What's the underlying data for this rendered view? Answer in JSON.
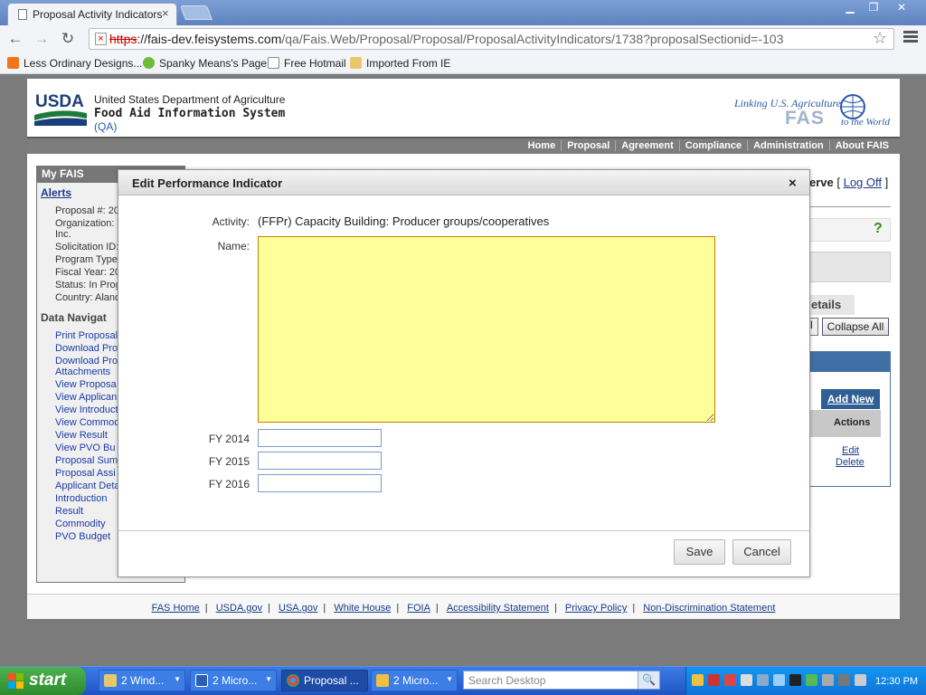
{
  "browser": {
    "tab_title": "Proposal Activity Indicators",
    "tab_close": "×",
    "url_scheme": "https",
    "url_host": "://fais-dev.feisystems.com",
    "url_path": "/qa/Fais.Web/Proposal/Proposal/ProposalActivityIndicators/1738?proposalSectionid=-103",
    "bookmarks": [
      "Less Ordinary Designs...",
      "Spanky Means's Page",
      "Free Hotmail",
      "Imported From IE"
    ]
  },
  "site": {
    "agency": "United States Department of Agriculture",
    "system": "Food Aid Information System",
    "env": "(QA)",
    "logo": "USDA",
    "brand_tagline": "Linking U.S. Agriculture",
    "brand_fas": "FAS",
    "brand_world": "to the World",
    "nav": [
      "Home",
      "Proposal",
      "Agreement",
      "Compliance",
      "Administration",
      "About FAIS"
    ]
  },
  "sidebar": {
    "title": "My FAIS",
    "alerts": "Alerts",
    "info": [
      "Proposal #: 20",
      "Organization: T",
      "Inc.",
      "Solicitation ID:",
      "Program Type:",
      "Fiscal Year: 20",
      "Status: In Prog",
      "Country: Alanc"
    ],
    "data_nav_title": "Data Navigat",
    "links": [
      "Print Proposal",
      "Download Pro",
      "Download Pro",
      "Attachments",
      "View Proposa",
      "View Applican",
      "View Introduct",
      "View Commod",
      "View Result",
      "View PVO Bu",
      "Proposal Summ",
      "Proposal Assi",
      "Applicant Deta",
      "Introduction",
      "Result",
      "Commodity",
      "PVO Budget"
    ]
  },
  "background": {
    "user_suffix": "erve",
    "logoff": "Log Off",
    "help": "?",
    "details": "etails",
    "expand_frag": "l",
    "collapse_all": "Collapse All",
    "add_new": "Add New",
    "actions_header": "Actions",
    "edit": "Edit",
    "delete": "Delete"
  },
  "dialog": {
    "title": "Edit Performance Indicator",
    "close": "×",
    "activity_label": "Activity:",
    "activity_value": "(FFPr) Capacity Building: Producer groups/cooperatives",
    "name_label": "Name:",
    "name_value": "",
    "fy_labels": [
      "FY 2014",
      "FY 2015",
      "FY 2016"
    ],
    "fy_values": [
      "",
      "",
      ""
    ],
    "save": "Save",
    "cancel": "Cancel"
  },
  "footer": {
    "links": [
      "FAS Home",
      "USDA.gov",
      "USA.gov",
      "White House",
      "FOIA",
      "Accessibility Statement",
      "Privacy Policy",
      "Non-Discrimination Statement"
    ],
    "separator": "|"
  },
  "taskbar": {
    "start": "start",
    "buttons": [
      "2 Wind...",
      "2 Micro...",
      "Proposal ...",
      "2 Micro..."
    ],
    "search_placeholder": "Search Desktop",
    "clock": "12:30 PM"
  },
  "colors": {
    "name_field_bg": "#ffff99",
    "navbar": "#7d7d7d",
    "taskbar": "#245edb",
    "start": "#3c9a3c"
  }
}
